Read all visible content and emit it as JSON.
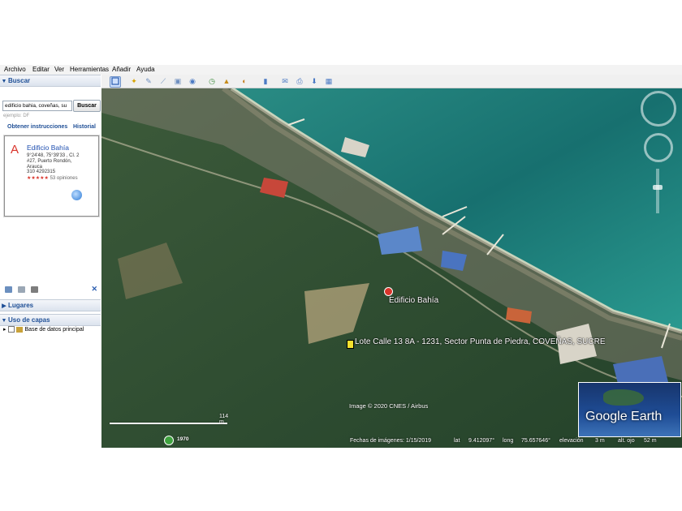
{
  "menu": [
    "Archivo",
    "Editar",
    "Ver",
    "Herramientas",
    "Añadir",
    "Ayuda"
  ],
  "sidebar": {
    "search_title": "Buscar",
    "search_value": "edificio bahia, coveñas, su",
    "search_button": "Buscar",
    "example_hint": "ejemplo: DF",
    "get_directions": "Obtener instrucciones",
    "history": "Historial",
    "result": {
      "marker": "A",
      "title": "Edificio Bahía",
      "address_lines": [
        "9°24'48, 75°39'33 , Cl. 2",
        "#27, Puerto Rondón,",
        "Arauca"
      ],
      "phone": "310 4292315",
      "stars": "★★★★★",
      "reviews": "53 opiniones"
    },
    "places_title": "Lugares",
    "layers_title": "Uso de capas",
    "layer_item": "Base de datos principal"
  },
  "toolbar": {
    "icons": [
      "sidebar-toggle-icon",
      "placemark-icon",
      "polygon-icon",
      "path-icon",
      "overlay-icon",
      "tour-icon",
      "history-icon",
      "sun-icon",
      "planets-icon",
      "ruler-icon",
      "email-icon",
      "print-icon",
      "save-image-icon",
      "maps-icon"
    ]
  },
  "map": {
    "placemark_building": "Edificio Bahía",
    "placemark_lot": "Lote Calle 13 8A - 1231, Sector Punta de Piedra, COVEÑAS, SUCRE",
    "copyright": "Image © 2020 CNES / Airbus",
    "scale_label": "114 m",
    "time_label": "1970",
    "status": {
      "imagery_date": "Fechas de imágenes: 1/15/2019",
      "lat_label": "lat",
      "lat_value": "9.412097°",
      "lon_label": "long",
      "lon_value": "75.657646°",
      "elev_label": "elevación",
      "elev_value": "3 m",
      "eye_label": "alt. ojo",
      "eye_value": "52 m"
    },
    "logo": "Google Earth"
  }
}
